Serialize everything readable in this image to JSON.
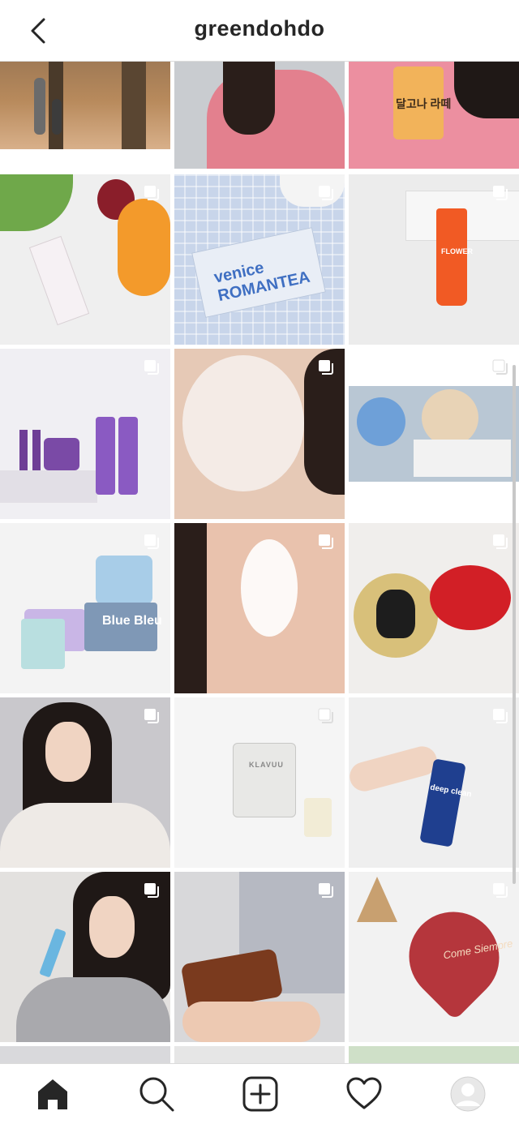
{
  "header": {
    "title": "greendohdo"
  },
  "grid": {
    "tiles": [
      {
        "label": ""
      },
      {
        "label": ""
      },
      {
        "label": "달고나 라떼"
      },
      {
        "label": ""
      },
      {
        "label": "venice ROMANTEA"
      },
      {
        "label": "FLOWER"
      },
      {
        "label": ""
      },
      {
        "label": ""
      },
      {
        "label": ""
      },
      {
        "label": "Blue Bleu"
      },
      {
        "label": ""
      },
      {
        "label": ""
      },
      {
        "label": ""
      },
      {
        "label": "KLAVUU"
      },
      {
        "label": "deep clean"
      },
      {
        "label": ""
      },
      {
        "label": ""
      },
      {
        "label": "Come Siempre"
      }
    ]
  },
  "tabbar": {
    "items": [
      "home-icon",
      "search-icon",
      "new-post-icon",
      "activity-heart-icon",
      "profile-avatar-icon"
    ]
  }
}
